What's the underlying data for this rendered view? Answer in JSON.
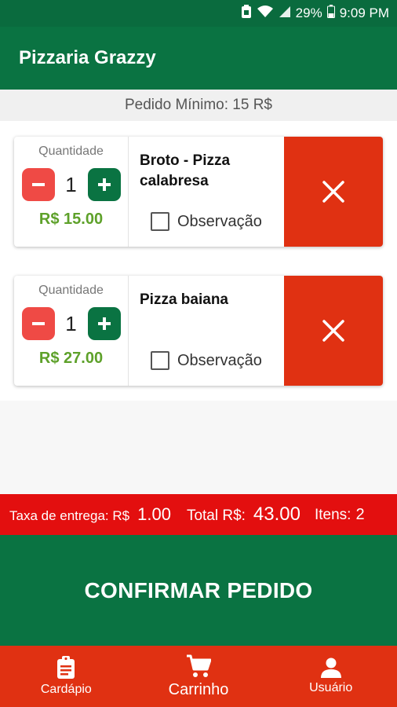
{
  "status_bar": {
    "battery": "29%",
    "time": "9:09 PM"
  },
  "app": {
    "title": "Pizzaria Grazzy"
  },
  "min_order": "Pedido Mínimo: 15 R$",
  "cart": {
    "items": [
      {
        "qty_label": "Quantidade",
        "qty": "1",
        "price": "R$ 15.00",
        "name": "Broto - Pizza calabresa",
        "note_label": "Observação"
      },
      {
        "qty_label": "Quantidade",
        "qty": "1",
        "price": "R$ 27.00",
        "name": "Pizza baiana",
        "note_label": "Observação"
      }
    ]
  },
  "summary": {
    "delivery_label": "Taxa de entrega: R$",
    "delivery_value": "1.00",
    "total_label": "Total R$:",
    "total_value": "43.00",
    "items_label": "Itens:",
    "items_value": "2"
  },
  "confirm_label": "CONFIRMAR PEDIDO",
  "nav": [
    {
      "label": "Cardápio",
      "icon": "clipboard-icon"
    },
    {
      "label": "Carrinho",
      "icon": "cart-icon"
    },
    {
      "label": "Usuário",
      "icon": "user-icon"
    }
  ],
  "colors": {
    "primary_green": "#0a7342",
    "accent_red": "#e03112",
    "total_red": "#e30f0f",
    "price_green": "#5ea12a"
  }
}
